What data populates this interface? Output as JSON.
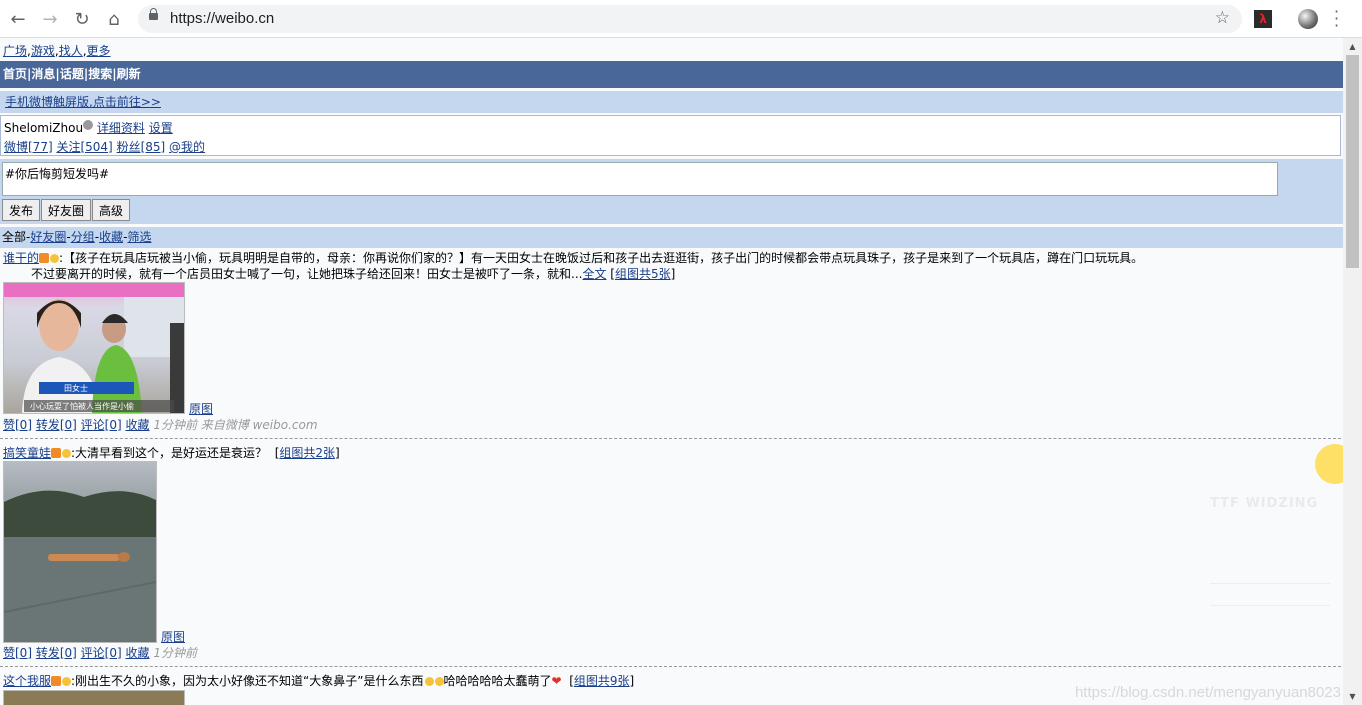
{
  "browser": {
    "url": "https://weibo.cn"
  },
  "topnav": [
    "广场",
    "游戏",
    "找人",
    "更多"
  ],
  "mainnav": [
    "首页",
    "消息",
    "话题",
    "搜索",
    "刷新"
  ],
  "mobile_link": "手机微博触屏版,点击前往>>",
  "user": {
    "name": "ShelomiZhou",
    "profile_link": "详细资料",
    "settings_link": "设置",
    "weibo_count": "微博[77]",
    "follow_count": "关注[504]",
    "fans_count": "粉丝[85]",
    "at_me": "@我的"
  },
  "compose": {
    "text": "#你后悔剪短发吗#",
    "publish": "发布",
    "friends": "好友圈",
    "advanced": "高级"
  },
  "filter": {
    "all": "全部",
    "friends": "好友圈",
    "group": "分组",
    "fav": "收藏",
    "screen": "筛选"
  },
  "posts": [
    {
      "author": "谁干的",
      "line1": ":【孩子在玩具店玩被当小偷，玩具明明是自带的，母亲：你再说你们家的？】有一天田女士在晚饭过后和孩子出去逛逛街，孩子出门的时候都会带点玩具珠子，孩子是来到了一个玩具店，蹲在门口玩玩具。",
      "line2": "不过要离开的时候，就有一个店员田女士喊了一句，让她把珠子给还回来！田女士是被吓了一条，就和...",
      "fulltext": "全文",
      "group_images": "组图共5张",
      "orig": "原图",
      "image_caption": "田女士",
      "image_sub": "小心玩耍了怕被人当作是小偷",
      "like": "赞[0]",
      "repost": "转发[0]",
      "comment": "评论[0]",
      "fav": "收藏",
      "meta": "1分钟前 来自微博 weibo.com"
    },
    {
      "author": "搞笑童娃",
      "line1": ":大清早看到这个，是好运还是衰运？",
      "group_images": "组图共2张",
      "orig": "原图",
      "like": "赞[0]",
      "repost": "转发[0]",
      "comment": "评论[0]",
      "fav": "收藏",
      "meta": "1分钟前"
    },
    {
      "author": "这个我服",
      "line1": ":刚出生不久的小象，因为太小好像还不知道“大象鼻子”是什么东西",
      "line1_tail": "哈哈哈哈哈太蠢萌了",
      "group_images": "组图共9张"
    }
  ],
  "watermark": "https://blog.csdn.net/mengyanyuan8023",
  "float_text": "TTF WIDZING"
}
